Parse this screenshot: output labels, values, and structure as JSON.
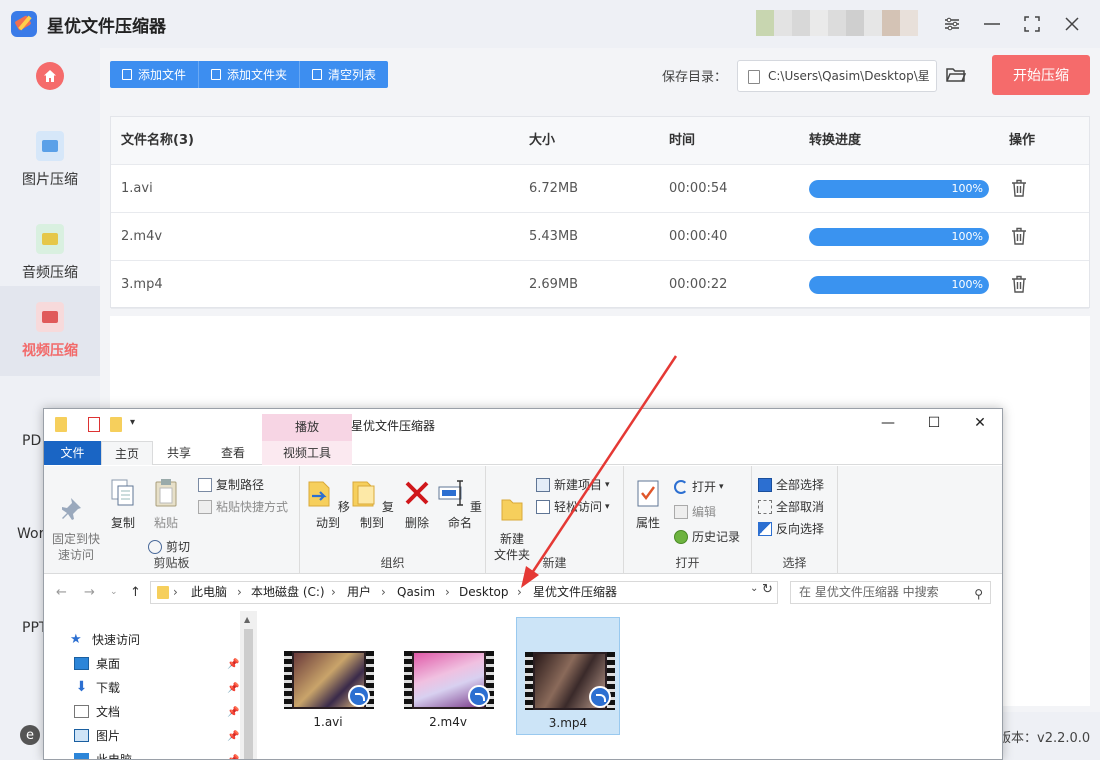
{
  "app": {
    "title": "星优文件压缩器",
    "version": "版本：v2.2.0.0"
  },
  "colors": {
    "accent": "#3d8ef0",
    "start_button": "#f56b6b",
    "sidebar_active_text": "#f26a6a",
    "progress": "#3a93f0",
    "explorer_file_tab": "#1a65c4",
    "play_tab": "#f7d5e4",
    "annotation_arrow": "#e53935"
  },
  "sidebar": {
    "items": [
      {
        "label": "图片压缩",
        "icon": "image-icon"
      },
      {
        "label": "音频压缩",
        "icon": "audio-icon"
      },
      {
        "label": "视频压缩",
        "icon": "video-icon",
        "active": true
      }
    ],
    "partial_items": [
      "PD",
      "Wor",
      "PPT"
    ]
  },
  "toolbar": {
    "add_file": "添加文件",
    "add_folder": "添加文件夹",
    "clear_list": "清空列表",
    "save_label": "保存目录：",
    "save_path": "C:\\Users\\Qasim\\Desktop\\星",
    "start": "开始压缩"
  },
  "table": {
    "headers": {
      "name": "文件名称(3)",
      "size": "大小",
      "time": "时间",
      "progress": "转换进度",
      "action": "操作"
    },
    "rows": [
      {
        "name": "1.avi",
        "size": "6.72MB",
        "time": "00:00:54",
        "progress": "100%",
        "progress_value": 100
      },
      {
        "name": "2.m4v",
        "size": "5.43MB",
        "time": "00:00:40",
        "progress": "100%",
        "progress_value": 100
      },
      {
        "name": "3.mp4",
        "size": "2.69MB",
        "time": "00:00:22",
        "progress": "100%",
        "progress_value": 100
      }
    ]
  },
  "explorer": {
    "title": "星优文件压缩器",
    "context_tab_top": "播放",
    "tabs": {
      "file": "文件",
      "home": "主页",
      "share": "共享",
      "view": "查看",
      "video_tools": "视频工具"
    },
    "ribbon": {
      "clipboard": {
        "group": "剪贴板",
        "pin": "固定到快\n速访问",
        "copy": "复制",
        "paste": "粘贴",
        "copy_path": "复制路径",
        "paste_shortcut": "粘贴快捷方式",
        "cut": "剪切"
      },
      "organize": {
        "group": "组织",
        "move_to": "移动到",
        "copy_to": "复制到",
        "delete": "删除",
        "rename": "重命名"
      },
      "new": {
        "group": "新建",
        "new_folder": "新建\n文件夹",
        "new_item": "新建项目",
        "easy_access": "轻松访问"
      },
      "open": {
        "group": "打开",
        "properties": "属性",
        "open": "打开",
        "edit": "编辑",
        "history": "历史记录"
      },
      "select": {
        "group": "选择",
        "select_all": "全部选择",
        "select_none": "全部取消",
        "invert": "反向选择"
      }
    },
    "breadcrumb": [
      "此电脑",
      "本地磁盘 (C:)",
      "用户",
      "Qasim",
      "Desktop",
      "星优文件压缩器"
    ],
    "search_placeholder": "在 星优文件压缩器 中搜索",
    "nav": [
      {
        "label": "快速访问",
        "icon": "star-icon"
      },
      {
        "label": "桌面",
        "icon": "desktop-icon",
        "pinned": true
      },
      {
        "label": "下载",
        "icon": "download-icon",
        "pinned": true
      },
      {
        "label": "文档",
        "icon": "document-icon",
        "pinned": true
      },
      {
        "label": "图片",
        "icon": "picture-icon",
        "pinned": true
      },
      {
        "label": "此电脑",
        "icon": "computer-icon",
        "pinned": true
      }
    ],
    "files": [
      {
        "name": "1.avi",
        "selected": false
      },
      {
        "name": "2.m4v",
        "selected": false
      },
      {
        "name": "3.mp4",
        "selected": true
      }
    ]
  }
}
